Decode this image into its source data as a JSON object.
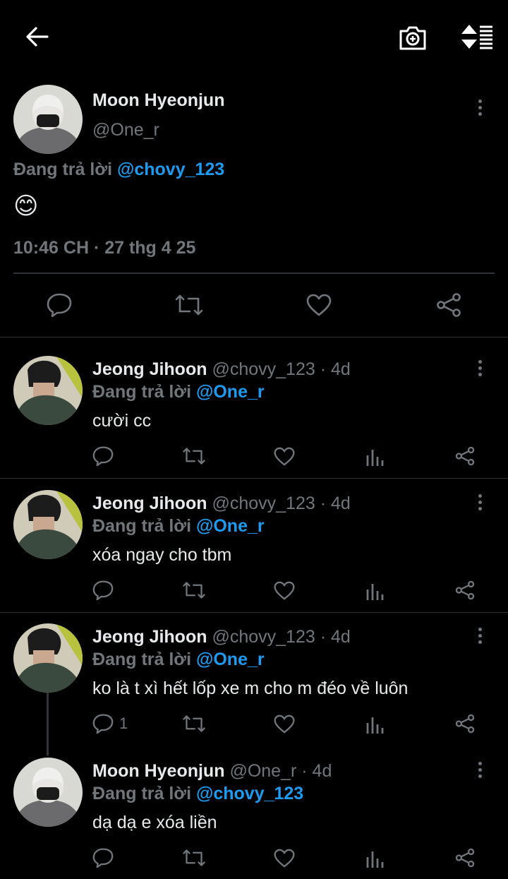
{
  "header": {
    "back": "back-arrow",
    "camera": "add-photo",
    "sort": "sort-replies"
  },
  "main_tweet": {
    "name": "Moon Hyeonjun",
    "handle": "@One_r",
    "replying_prefix": "Đang trả lời",
    "replying_to": "@chovy_123",
    "text": "😊",
    "timestamp": "10:46 CH · 27 thg 4 25"
  },
  "replies": [
    {
      "name": "Jeong Jihoon",
      "handle": "@chovy_123",
      "time": "· 4d",
      "replying_prefix": "Đang trả lời",
      "replying_to": "@One_r",
      "text": "cười cc",
      "reply_count": ""
    },
    {
      "name": "Jeong Jihoon",
      "handle": "@chovy_123",
      "time": "· 4d",
      "replying_prefix": "Đang trả lời",
      "replying_to": "@One_r",
      "text": "xóa ngay cho tbm",
      "reply_count": ""
    },
    {
      "name": "Jeong Jihoon",
      "handle": "@chovy_123",
      "time": "· 4d",
      "replying_prefix": "Đang trả lời",
      "replying_to": "@One_r",
      "text": "ko là t xì hết lốp xe m cho m đéo về luôn",
      "reply_count": "1"
    },
    {
      "name": "Moon Hyeonjun",
      "handle": "@One_r",
      "time": "· 4d",
      "replying_prefix": "Đang trả lời",
      "replying_to": "@chovy_123",
      "text": "dạ dạ e xóa liền",
      "reply_count": ""
    }
  ],
  "colors": {
    "accent": "#1d9bf0",
    "muted": "#71767b",
    "bg": "#000000",
    "divider": "#2f3336"
  }
}
